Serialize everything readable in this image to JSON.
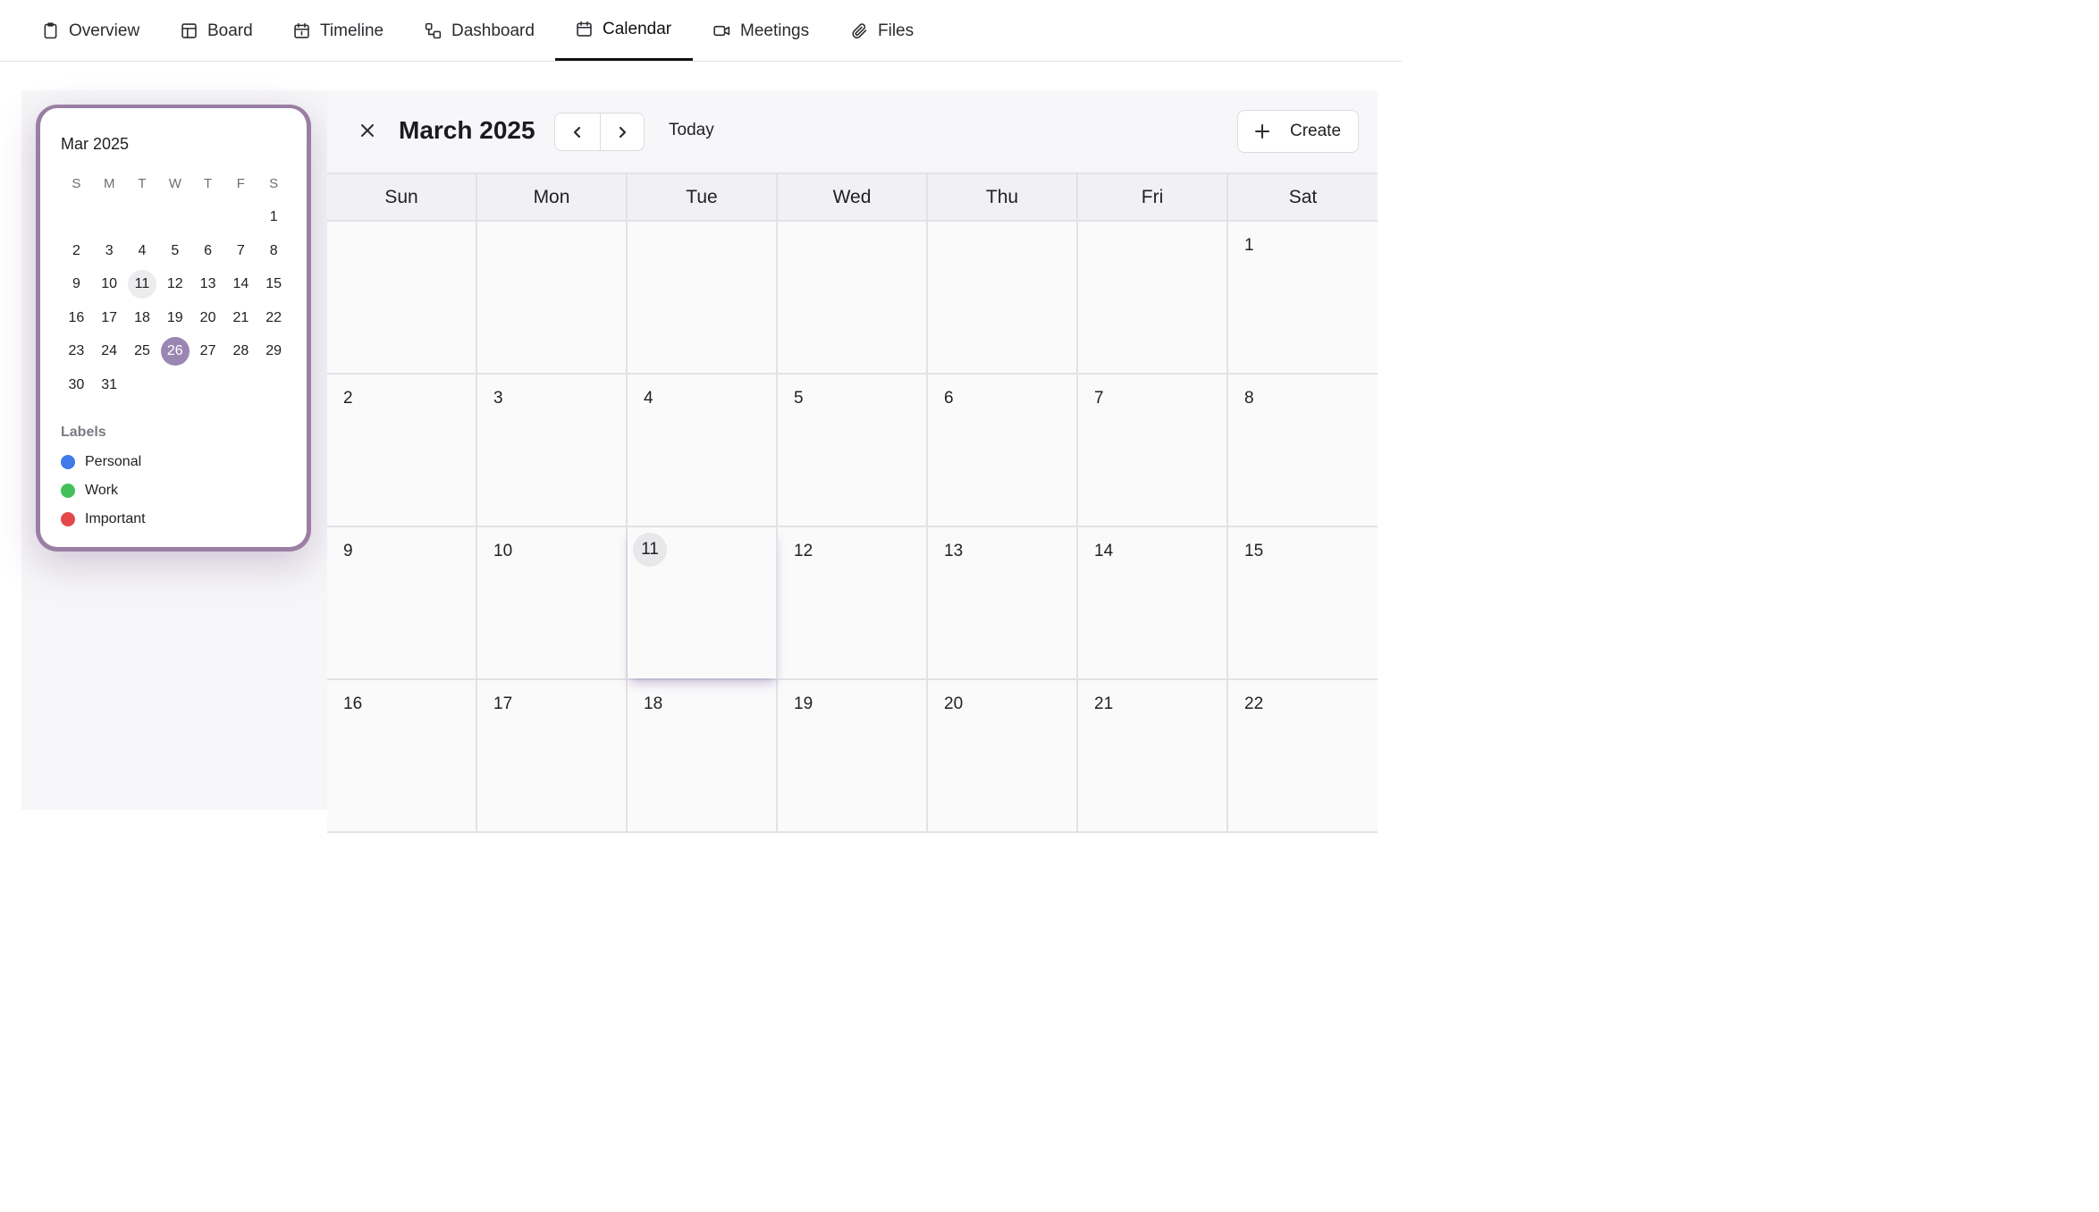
{
  "nav": {
    "tabs": [
      {
        "label": "Overview",
        "icon": "clipboard-icon"
      },
      {
        "label": "Board",
        "icon": "board-icon"
      },
      {
        "label": "Timeline",
        "icon": "calendar-icon"
      },
      {
        "label": "Dashboard",
        "icon": "dashboard-icon"
      },
      {
        "label": "Calendar",
        "icon": "calendar-icon",
        "active": true
      },
      {
        "label": "Meetings",
        "icon": "video-icon"
      },
      {
        "label": "Files",
        "icon": "paperclip-icon"
      }
    ]
  },
  "mini_calendar": {
    "title": "Mar 2025",
    "weekdays": [
      "S",
      "M",
      "T",
      "W",
      "T",
      "F",
      "S"
    ],
    "weeks": [
      [
        "",
        "",
        "",
        "",
        "",
        "",
        "1"
      ],
      [
        "2",
        "3",
        "4",
        "5",
        "6",
        "7",
        "8"
      ],
      [
        "9",
        "10",
        "11",
        "12",
        "13",
        "14",
        "15"
      ],
      [
        "16",
        "17",
        "18",
        "19",
        "20",
        "21",
        "22"
      ],
      [
        "23",
        "24",
        "25",
        "26",
        "27",
        "28",
        "29"
      ],
      [
        "30",
        "31",
        "",
        "",
        "",
        "",
        ""
      ]
    ],
    "today": "11",
    "selected": "26"
  },
  "labels": {
    "title": "Labels",
    "items": [
      {
        "name": "Personal",
        "color": "#3f7ae8"
      },
      {
        "name": "Work",
        "color": "#44c05a"
      },
      {
        "name": "Important",
        "color": "#e54848"
      }
    ]
  },
  "header": {
    "month_title": "March 2025",
    "today_label": "Today",
    "create_label": "Create"
  },
  "grid": {
    "weekdays": [
      "Sun",
      "Mon",
      "Tue",
      "Wed",
      "Thu",
      "Fri",
      "Sat"
    ],
    "weeks": [
      [
        "",
        "",
        "",
        "",
        "",
        "",
        "1"
      ],
      [
        "2",
        "3",
        "4",
        "5",
        "6",
        "7",
        "8"
      ],
      [
        "9",
        "10",
        "11",
        "12",
        "13",
        "14",
        "15"
      ],
      [
        "16",
        "17",
        "18",
        "19",
        "20",
        "21",
        "22"
      ]
    ],
    "today": "11"
  },
  "colors": {
    "accent": "#9a86b2",
    "card_border": "#9a7ea3"
  }
}
